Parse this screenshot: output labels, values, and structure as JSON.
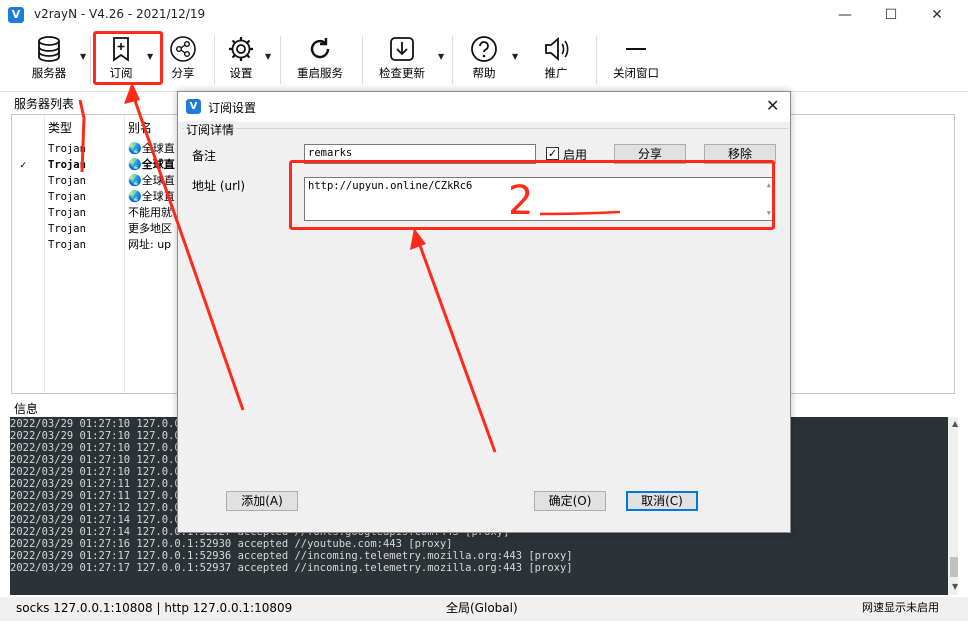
{
  "window": {
    "title": "v2rayN - V4.26 - 2021/12/19",
    "minimize": "—",
    "maximize": "☐",
    "close": "✕"
  },
  "toolbar": {
    "servers": "服务器",
    "subscribe": "订阅",
    "share": "分享",
    "settings": "设置",
    "restart": "重启服务",
    "check_update": "检查更新",
    "help": "帮助",
    "promote": "推广",
    "close_window": "关闭窗口"
  },
  "server_list": {
    "label": "服务器列表",
    "columns": [
      "类型",
      "别名"
    ],
    "rows": [
      {
        "active": "",
        "type": "Trojan",
        "alias": "🌏全球直"
      },
      {
        "active": "✓",
        "type": "Trojan",
        "alias": "🌏全球直"
      },
      {
        "active": "",
        "type": "Trojan",
        "alias": "🌏全球直"
      },
      {
        "active": "",
        "type": "Trojan",
        "alias": "🌏全球直"
      },
      {
        "active": "",
        "type": "Trojan",
        "alias": "不能用就"
      },
      {
        "active": "",
        "type": "Trojan",
        "alias": "更多地区"
      },
      {
        "active": "",
        "type": "Trojan",
        "alias": "网址: up"
      }
    ]
  },
  "info": {
    "label": "信息",
    "log_lines": [
      "2022/03/29 01:27:10 127.0.0.1",
      "2022/03/29 01:27:10 127.0.0.1",
      "2022/03/29 01:27:10 127.0.0.1",
      "2022/03/29 01:27:10 127.0.0.1",
      "2022/03/29 01:27:10 127.0.0.1",
      "2022/03/29 01:27:11 127.0.0.1",
      "2022/03/29 01:27:11 127.0.0.1",
      "2022/03/29 01:27:12 127.0.0.1",
      "2022/03/29 01:27:14 127.0.0.1",
      "2022/03/29 01:27:14 127.0.0.1:52927 accepted //fonts.googleapis.com:443 [proxy]",
      "2022/03/29 01:27:16 127.0.0.1:52930 accepted //youtube.com:443 [proxy]",
      "2022/03/29 01:27:17 127.0.0.1:52936 accepted //incoming.telemetry.mozilla.org:443 [proxy]",
      "2022/03/29 01:27:17 127.0.0.1:52937 accepted //incoming.telemetry.mozilla.org:443 [proxy]"
    ]
  },
  "status": {
    "ports": "socks 127.0.0.1:10808 | http 127.0.0.1:10809",
    "mode": "全局(Global)",
    "speed": "网速显示未启用"
  },
  "dialog": {
    "title": "订阅设置",
    "close": "✕",
    "group_label": "订阅详情",
    "remarks_label": "备注",
    "remarks_value": "remarks",
    "enable_label": "启用",
    "enable_checked": "✓",
    "share_button": "分享",
    "remove_button": "移除",
    "url_label": "地址 (url)",
    "url_value": "http://upyun.online/CZkRc6",
    "add_button": "添加(A)",
    "ok_button": "确定(O)",
    "cancel_button": "取消(C)"
  },
  "annotation": {
    "number_label": "2",
    "color": "#ff2a1a"
  }
}
